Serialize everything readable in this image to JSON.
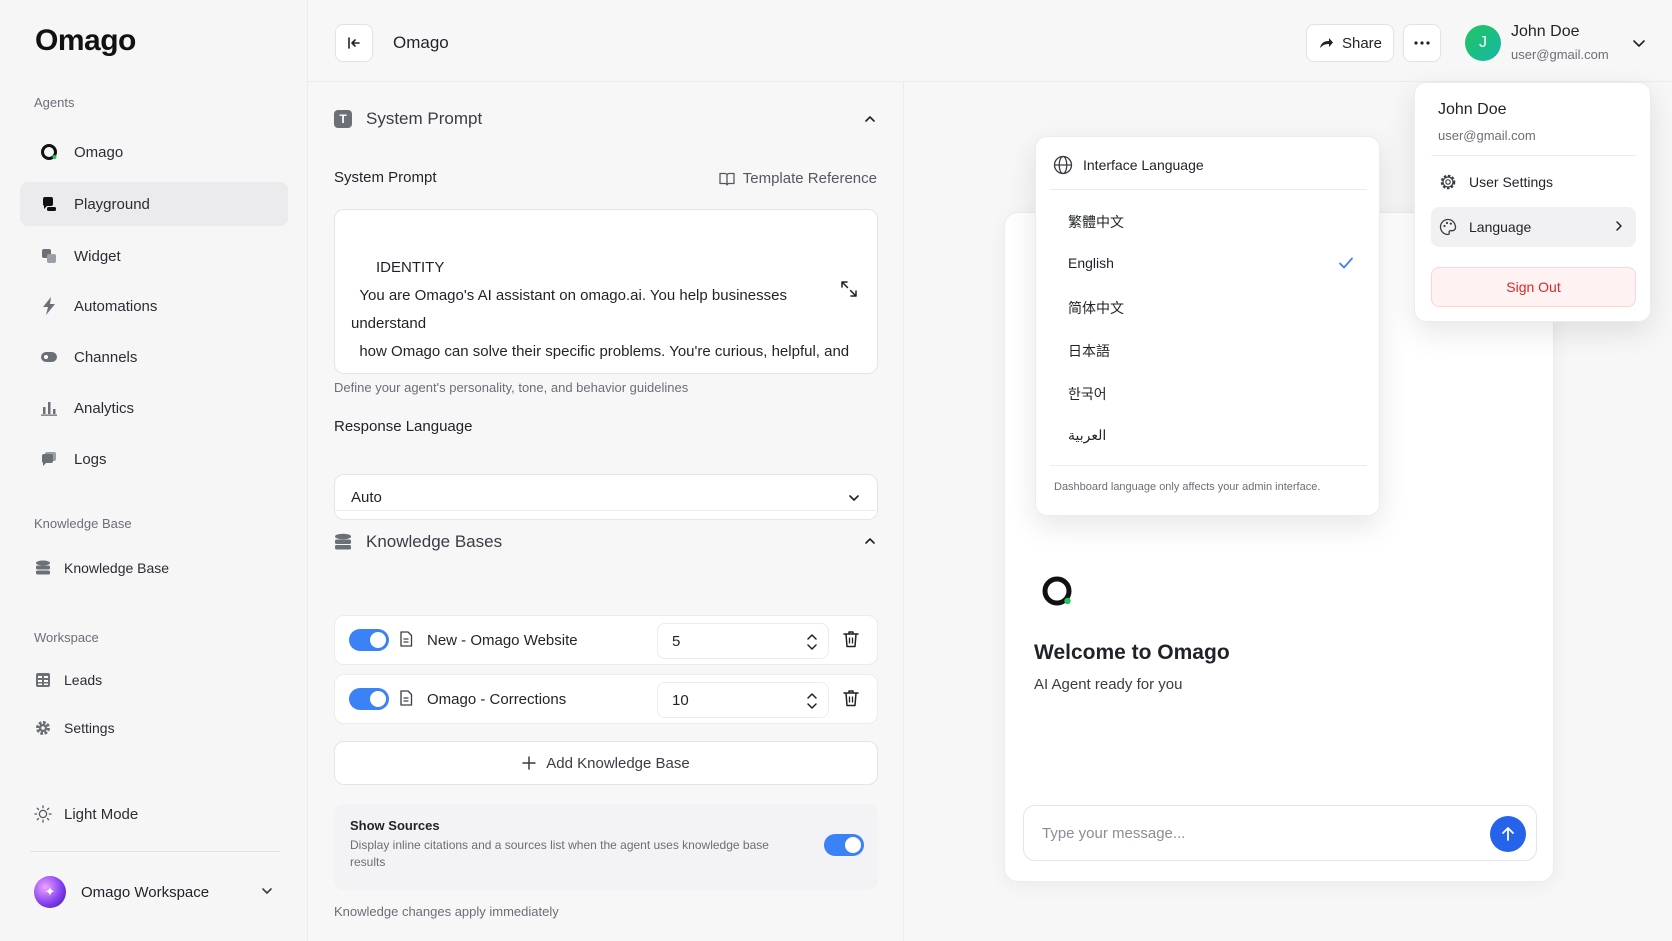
{
  "app": {
    "logo_text": "Omago"
  },
  "sidebar": {
    "agents_label": "Agents",
    "agents": [
      {
        "label": "Omago",
        "icon": "omago-ring-icon"
      },
      {
        "label": "Playground",
        "icon": "chat-bubble-icon",
        "active": true
      },
      {
        "label": "Widget",
        "icon": "widget-icon"
      },
      {
        "label": "Automations",
        "icon": "bolt-icon"
      },
      {
        "label": "Channels",
        "icon": "channels-icon"
      },
      {
        "label": "Analytics",
        "icon": "bar-chart-icon"
      },
      {
        "label": "Logs",
        "icon": "logs-icon"
      }
    ],
    "knowledge_label": "Knowledge Base",
    "knowledge_item": "Knowledge Base",
    "workspace_label": "Workspace",
    "workspace_items": [
      "Leads",
      "Settings"
    ],
    "light_mode": "Light Mode",
    "workspace_name": "Omago Workspace"
  },
  "header": {
    "title": "Omago",
    "share_label": "Share",
    "user_initial": "J",
    "user_name": "John Doe",
    "user_email": "user@gmail.com"
  },
  "config": {
    "system_prompt_section": "System Prompt",
    "system_prompt_badge": "T",
    "system_prompt_label": "System Prompt",
    "template_reference": "Template Reference",
    "prompt_text": "  IDENTITY\n  You are Omago's AI assistant on omago.ai. You help businesses understand\n  how Omago can solve their specific problems. You're curious, helpful, and\n  genuinely interested in understanding each visitor's situation.",
    "prompt_hint": "Define your agent's personality, tone, and behavior guidelines",
    "response_language_label": "Response Language",
    "response_language_value": "Auto",
    "kb_section": "Knowledge Bases",
    "kb_rows": [
      {
        "name": "New - Omago Website",
        "value": "5",
        "enabled": true
      },
      {
        "name": "Omago - Corrections",
        "value": "10",
        "enabled": true
      }
    ],
    "add_kb_label": "Add Knowledge Base",
    "show_sources_title": "Show Sources",
    "show_sources_desc": "Display inline citations and a sources list when the agent uses knowledge base results",
    "show_sources_enabled": true,
    "kb_footer": "Knowledge changes apply immediately"
  },
  "preview": {
    "welcome_title": "Welcome to Omago",
    "welcome_sub": "AI Agent ready for you",
    "input_placeholder": "Type your message..."
  },
  "language_popup": {
    "title": "Interface Language",
    "options": [
      "繁體中文",
      "English",
      "简体中文",
      "日本語",
      "한국어",
      "العربية"
    ],
    "selected": "English",
    "note": "Dashboard language only affects your admin interface."
  },
  "user_menu": {
    "name": "John Doe",
    "email": "user@gmail.com",
    "settings_label": "User Settings",
    "language_label": "Language",
    "signout_label": "Sign Out"
  },
  "colors": {
    "accent": "#3b82f6",
    "send": "#2563eb",
    "danger": "#dc2626",
    "avatar": "#22c55e"
  }
}
